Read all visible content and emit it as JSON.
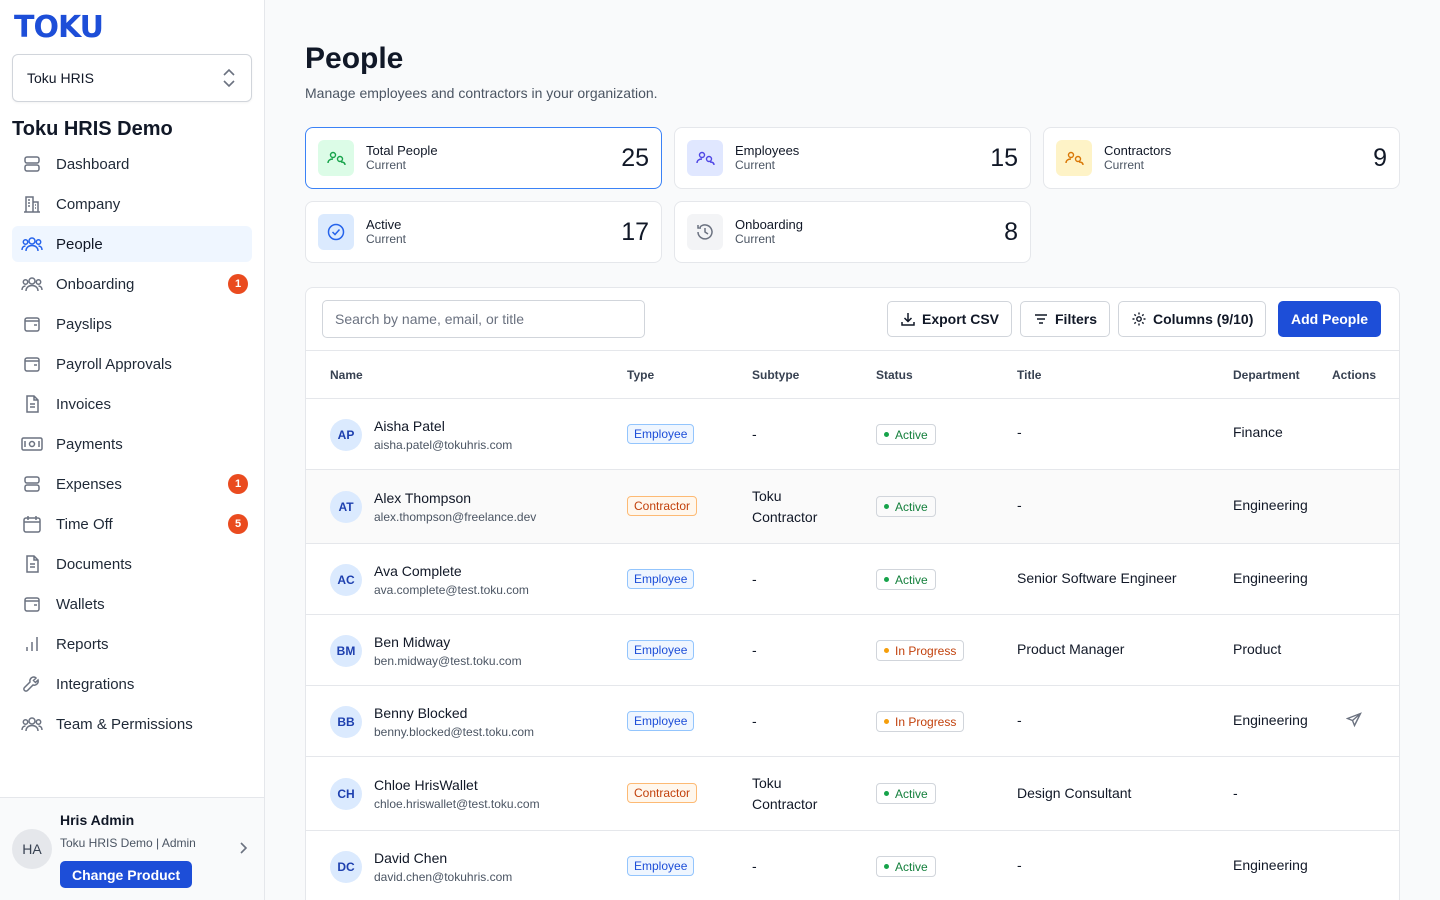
{
  "brand": {
    "logo": "TOKU",
    "color": "#1d4ed8"
  },
  "product_select": {
    "value": "Toku HRIS"
  },
  "org_title": "Toku HRIS Demo",
  "nav": [
    {
      "label": "Dashboard",
      "icon": "database-icon"
    },
    {
      "label": "Company",
      "icon": "building-icon"
    },
    {
      "label": "People",
      "icon": "users-icon",
      "active": true
    },
    {
      "label": "Onboarding",
      "icon": "users-icon",
      "badge": "1"
    },
    {
      "label": "Payslips",
      "icon": "wallet-icon"
    },
    {
      "label": "Payroll Approvals",
      "icon": "wallet-icon"
    },
    {
      "label": "Invoices",
      "icon": "file-icon"
    },
    {
      "label": "Payments",
      "icon": "banknote-icon"
    },
    {
      "label": "Expenses",
      "icon": "database-icon",
      "badge": "1"
    },
    {
      "label": "Time Off",
      "icon": "calendar-icon",
      "badge": "5"
    },
    {
      "label": "Documents",
      "icon": "file-icon"
    },
    {
      "label": "Wallets",
      "icon": "wallet-icon"
    },
    {
      "label": "Reports",
      "icon": "bar-chart-icon"
    },
    {
      "label": "Integrations",
      "icon": "wrench-icon"
    },
    {
      "label": "Team & Permissions",
      "icon": "users-icon"
    }
  ],
  "user": {
    "initials": "HA",
    "name": "Hris Admin",
    "sub": "Toku HRIS Demo | Admin",
    "change_label": "Change Product"
  },
  "page": {
    "title": "People",
    "subtitle": "Manage employees and contractors in your organization."
  },
  "stats": [
    {
      "label": "Total People",
      "sub": "Current",
      "value": "25"
    },
    {
      "label": "Employees",
      "sub": "Current",
      "value": "15"
    },
    {
      "label": "Contractors",
      "sub": "Current",
      "value": "9"
    },
    {
      "label": "Active",
      "sub": "Current",
      "value": "17"
    },
    {
      "label": "Onboarding",
      "sub": "Current",
      "value": "8"
    }
  ],
  "toolbar": {
    "search_placeholder": "Search by name, email, or title",
    "export_label": "Export CSV",
    "filters_label": "Filters",
    "columns_label": "Columns (9/10)",
    "add_label": "Add People"
  },
  "columns": [
    "Name",
    "Type",
    "Subtype",
    "Status",
    "Title",
    "Department",
    "Actions"
  ],
  "rows": [
    {
      "initials": "AP",
      "name": "Aisha Patel",
      "email": "aisha.patel@tokuhris.com",
      "type": "Employee",
      "subtype": "-",
      "status": "Active",
      "title": "-",
      "department": "Finance"
    },
    {
      "initials": "AT",
      "name": "Alex Thompson",
      "email": "alex.thompson@freelance.dev",
      "type": "Contractor",
      "subtype": "Toku Contractor",
      "status": "Active",
      "title": "-",
      "department": "Engineering"
    },
    {
      "initials": "AC",
      "name": "Ava Complete",
      "email": "ava.complete@test.toku.com",
      "type": "Employee",
      "subtype": "-",
      "status": "Active",
      "title": "Senior Software Engineer",
      "department": "Engineering"
    },
    {
      "initials": "BM",
      "name": "Ben Midway",
      "email": "ben.midway@test.toku.com",
      "type": "Employee",
      "subtype": "-",
      "status": "In Progress",
      "title": "Product Manager",
      "department": "Product"
    },
    {
      "initials": "BB",
      "name": "Benny Blocked",
      "email": "benny.blocked@test.toku.com",
      "type": "Employee",
      "subtype": "-",
      "status": "In Progress",
      "title": "-",
      "department": "Engineering",
      "action_icon": "send-icon"
    },
    {
      "initials": "CH",
      "name": "Chloe HrisWallet",
      "email": "chloe.hriswallet@test.toku.com",
      "type": "Contractor",
      "subtype": "Toku Contractor",
      "status": "Active",
      "title": "Design Consultant",
      "department": "-"
    },
    {
      "initials": "DC",
      "name": "David Chen",
      "email": "david.chen@tokuhris.com",
      "type": "Employee",
      "subtype": "-",
      "status": "Active",
      "title": "-",
      "department": "Engineering"
    }
  ]
}
